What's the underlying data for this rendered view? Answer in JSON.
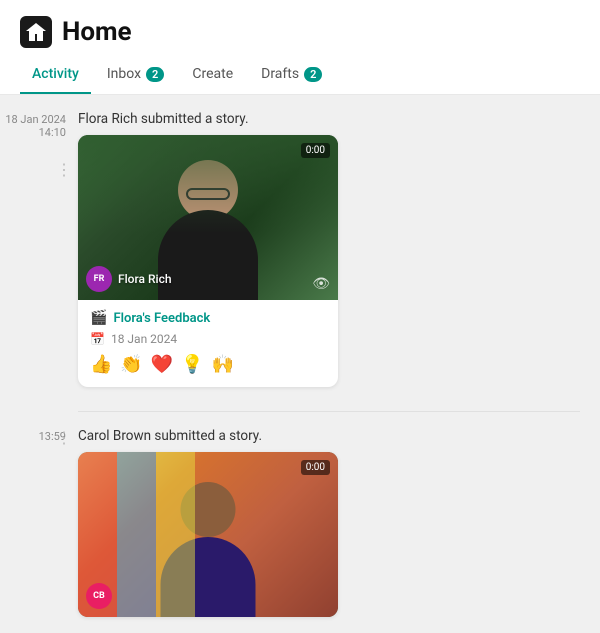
{
  "header": {
    "home_icon_label": "home",
    "title": "Home"
  },
  "tabs": [
    {
      "id": "activity",
      "label": "Activity",
      "active": true,
      "badge": null
    },
    {
      "id": "inbox",
      "label": "Inbox",
      "active": false,
      "badge": "2"
    },
    {
      "id": "create",
      "label": "Create",
      "active": false,
      "badge": null
    },
    {
      "id": "drafts",
      "label": "Drafts",
      "active": false,
      "badge": "2"
    }
  ],
  "activity": {
    "items": [
      {
        "date": "18 Jan 2024",
        "time": "14:10",
        "description": "Flora Rich submitted a story.",
        "card": {
          "duration": "0:00",
          "avatar_initials": "FR",
          "avatar_color": "#9c27b0",
          "person_name": "Flora Rich",
          "title_icon": "🎬",
          "title": "Flora's Feedback",
          "date_icon": "📅",
          "card_date": "18 Jan 2024",
          "reactions": [
            "👍",
            "👏",
            "❤️",
            "💡",
            "🙌"
          ]
        }
      },
      {
        "date": "13:59",
        "time": "",
        "description": "Carol Brown submitted a story.",
        "card": {
          "duration": "0:00",
          "avatar_initials": "CB",
          "avatar_color": "#e91e63"
        }
      }
    ]
  }
}
